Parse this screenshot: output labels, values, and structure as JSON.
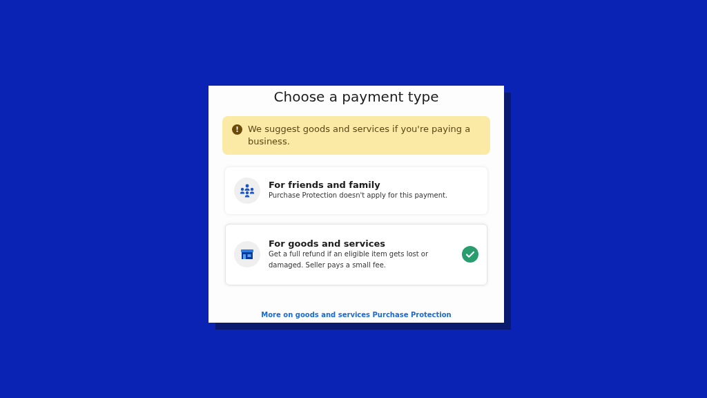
{
  "dialog": {
    "title": "Choose a payment type",
    "notice": {
      "icon": "!",
      "text": "We suggest goods and services if you're paying a business."
    },
    "options": [
      {
        "kind": "people",
        "title": "For friends and family",
        "description": "Purchase Protection doesn't apply for this payment.",
        "selected": false
      },
      {
        "kind": "store",
        "title": "For goods and services",
        "description": "Get a full refund if an eligible item gets lost or damaged. Seller pays a small fee.",
        "selected": true
      }
    ],
    "link": "More on goods and services Purchase Protection"
  }
}
